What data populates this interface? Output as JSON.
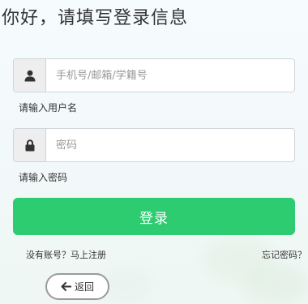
{
  "header": {
    "title": "你好，请填写登录信息"
  },
  "form": {
    "username": {
      "placeholder": "手机号/邮箱/学籍号",
      "value": "",
      "hint": "请输入用户名",
      "icon": "user-icon"
    },
    "password": {
      "placeholder": "密码",
      "value": "",
      "hint": "请输入密码",
      "icon": "lock-icon"
    },
    "submit_label": "登录"
  },
  "links": {
    "register": "没有账号？马上注册",
    "forgot": "忘记密码？"
  },
  "back": {
    "label": "返回",
    "icon": "arrow-left-icon"
  },
  "colors": {
    "accent": "#2ecc71",
    "addon_bg": "#eeeeee",
    "border": "#cfd5da"
  }
}
